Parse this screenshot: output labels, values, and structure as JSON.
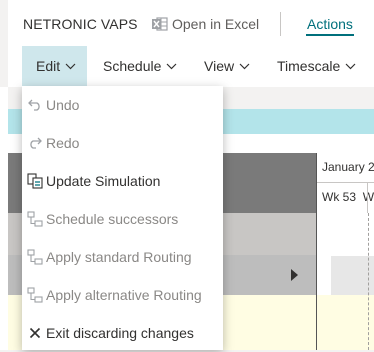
{
  "topbar": {
    "app_name": "NETRONIC VAPS",
    "open_in_excel": "Open in Excel",
    "actions": "Actions"
  },
  "menubar": {
    "items": [
      {
        "label": "Edit",
        "active": true
      },
      {
        "label": "Schedule"
      },
      {
        "label": "View"
      },
      {
        "label": "Timescale"
      }
    ]
  },
  "calendar": {
    "month": "January 2",
    "week": "Wk 53",
    "week_next": "W"
  },
  "edit_menu": {
    "items": [
      {
        "label": "Undo",
        "icon": "undo-icon",
        "enabled": false
      },
      {
        "label": "Redo",
        "icon": "redo-icon",
        "enabled": false
      },
      {
        "label": "Update Simulation",
        "icon": "update-simulation-icon",
        "enabled": true
      },
      {
        "label": "Schedule successors",
        "icon": "schedule-successors-icon",
        "enabled": false
      },
      {
        "label": "Apply standard Routing",
        "icon": "routing-icon",
        "enabled": false
      },
      {
        "label": "Apply alternative Routing",
        "icon": "routing-icon",
        "enabled": false
      },
      {
        "label": "Exit discarding changes",
        "icon": "close-icon",
        "enabled": true
      }
    ]
  },
  "colors": {
    "accent": "#00707c",
    "menu_active": "#cfe7ec",
    "banner": "#b3e4ea",
    "disabled_text": "#8a8886"
  }
}
